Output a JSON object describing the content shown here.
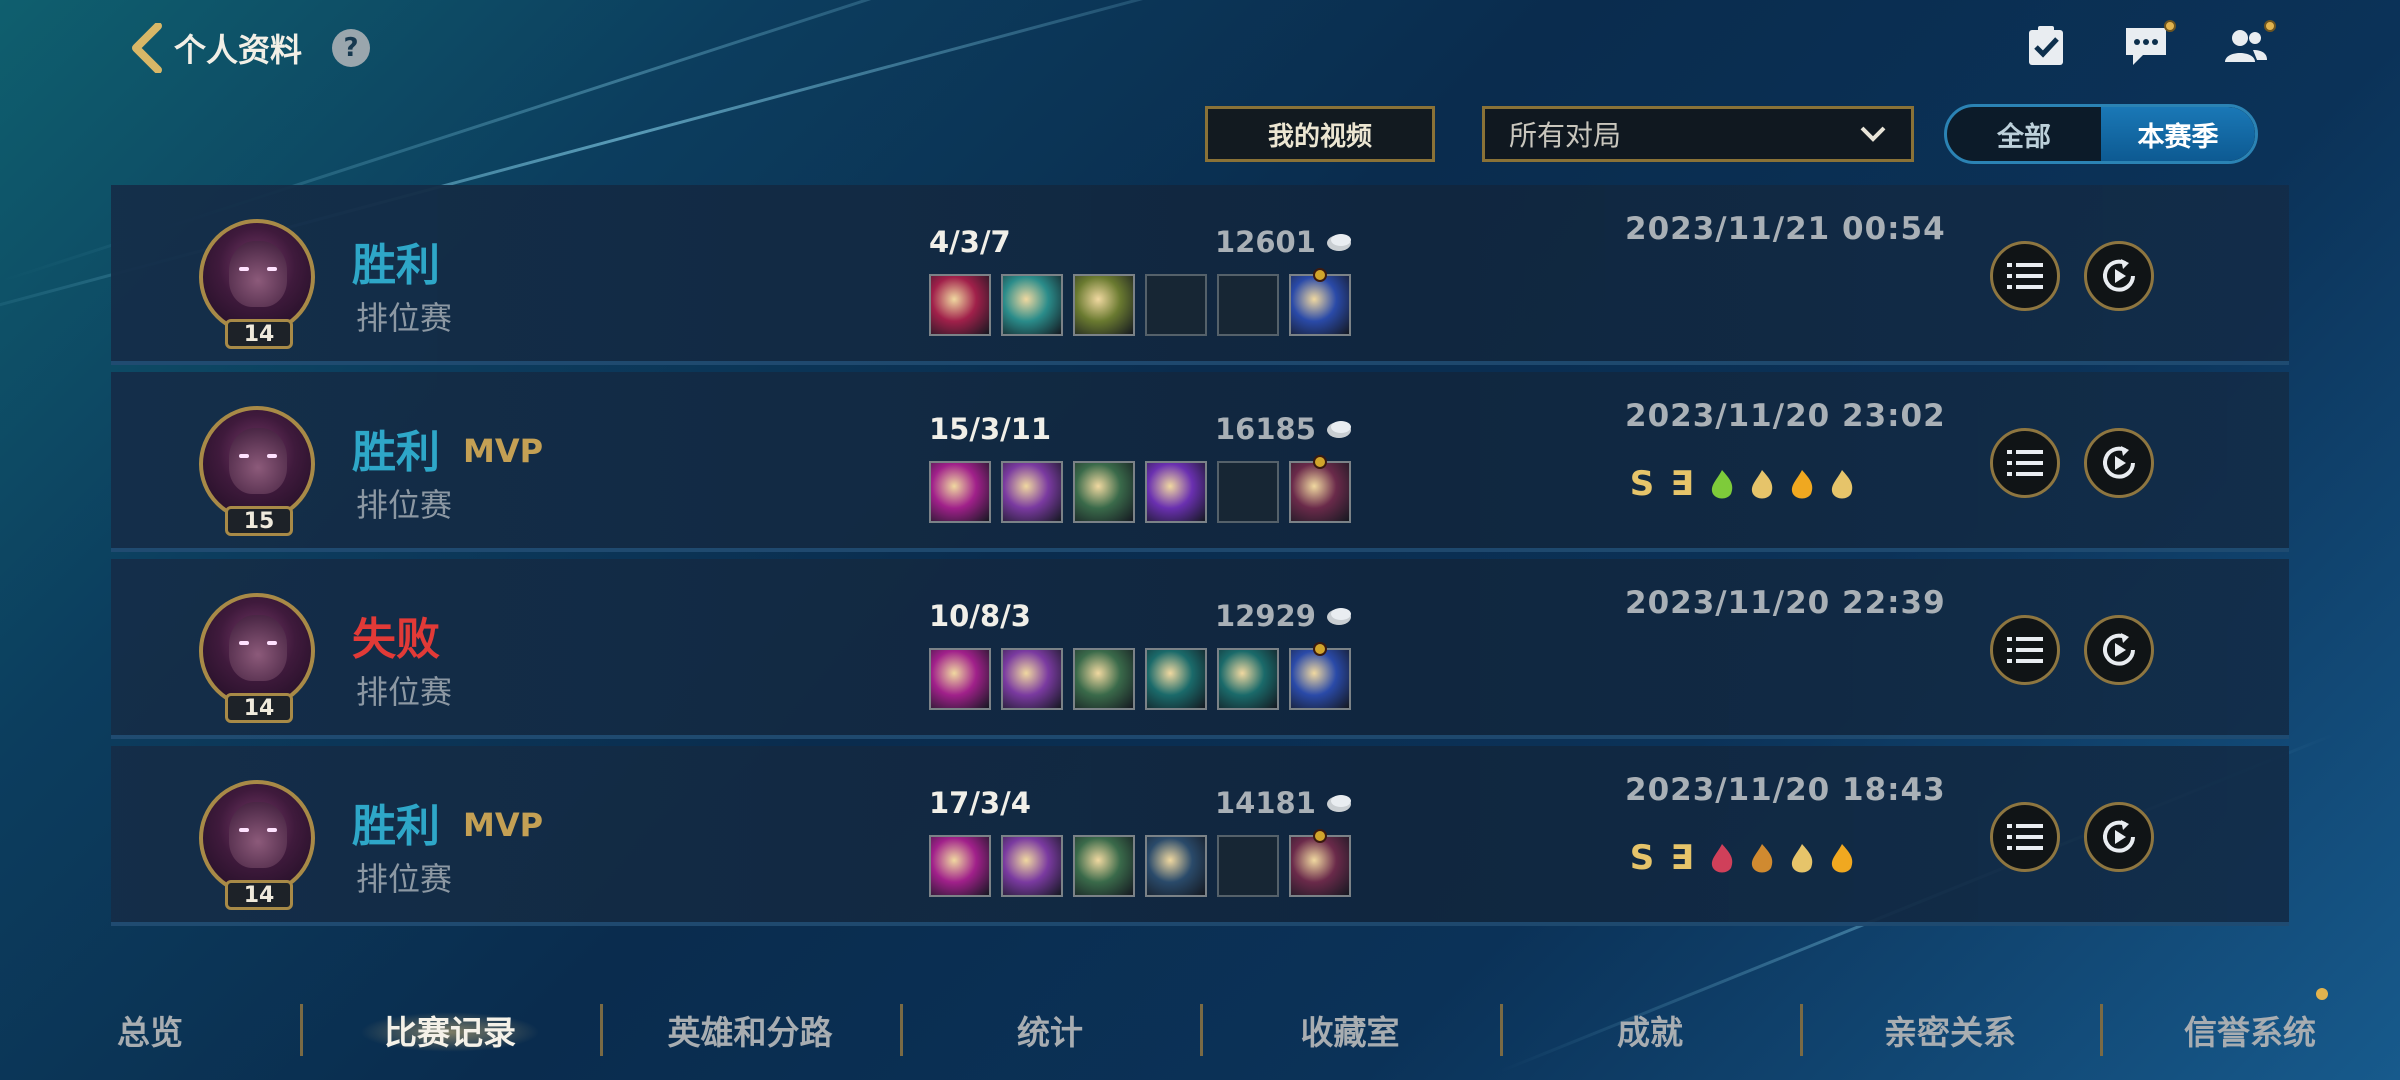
{
  "header": {
    "title": "个人资料",
    "help_label": "?"
  },
  "top_icons": [
    "checklist-icon",
    "chat-icon",
    "friends-icon"
  ],
  "filters": {
    "video_button": "我的视频",
    "match_select": "所有对局",
    "season_toggle": {
      "options": [
        "全部",
        "本赛季"
      ],
      "selected": "本赛季"
    }
  },
  "matches": [
    {
      "result": "胜利",
      "result_type": "win",
      "mvp": "",
      "mode": "排位赛",
      "level": "14",
      "kda": "4/3/7",
      "gold": "12601",
      "date": "2023/11/21 00:54",
      "items": [
        "#a0204a",
        "#2a8c8a",
        "#6a7a30",
        "",
        "",
        "#2a4aa8"
      ],
      "badges": []
    },
    {
      "result": "胜利",
      "result_type": "win",
      "mvp": "MVP",
      "mode": "排位赛",
      "level": "15",
      "kda": "15/3/11",
      "gold": "16185",
      "date": "2023/11/20 23:02",
      "items": [
        "#a0208a",
        "#7a3aa0",
        "#3a6a4a",
        "#6a30b0",
        "",
        "#6a2a4a"
      ],
      "badges": [
        "S",
        "∃",
        "flag",
        "flame",
        "fire",
        "coin"
      ]
    },
    {
      "result": "失败",
      "result_type": "loss",
      "mvp": "",
      "mode": "排位赛",
      "level": "14",
      "kda": "10/8/3",
      "gold": "12929",
      "date": "2023/11/20 22:39",
      "items": [
        "#a0208a",
        "#7a3aa0",
        "#3a6a4a",
        "#1a6a6a",
        "#1a6a6a",
        "#2a4aa8"
      ],
      "badges": []
    },
    {
      "result": "胜利",
      "result_type": "win",
      "mvp": "MVP",
      "mode": "排位赛",
      "level": "14",
      "kda": "17/3/4",
      "gold": "14181",
      "date": "2023/11/20 18:43",
      "items": [
        "#a0208a",
        "#7a3aa0",
        "#3a6a4a",
        "#2a4a6a",
        "",
        "#6a2a4a"
      ],
      "badges": [
        "S",
        "∃",
        "crown",
        "emblem",
        "flame",
        "fire"
      ]
    }
  ],
  "nav": [
    "总览",
    "比赛记录",
    "英雄和分路",
    "统计",
    "收藏室",
    "成就",
    "亲密关系",
    "信誉系统"
  ],
  "nav_active": 1,
  "colors": {
    "accent_gold": "#a88a47",
    "win": "#2ea7c8",
    "loss": "#e23a37",
    "mvp": "#c4a054"
  }
}
